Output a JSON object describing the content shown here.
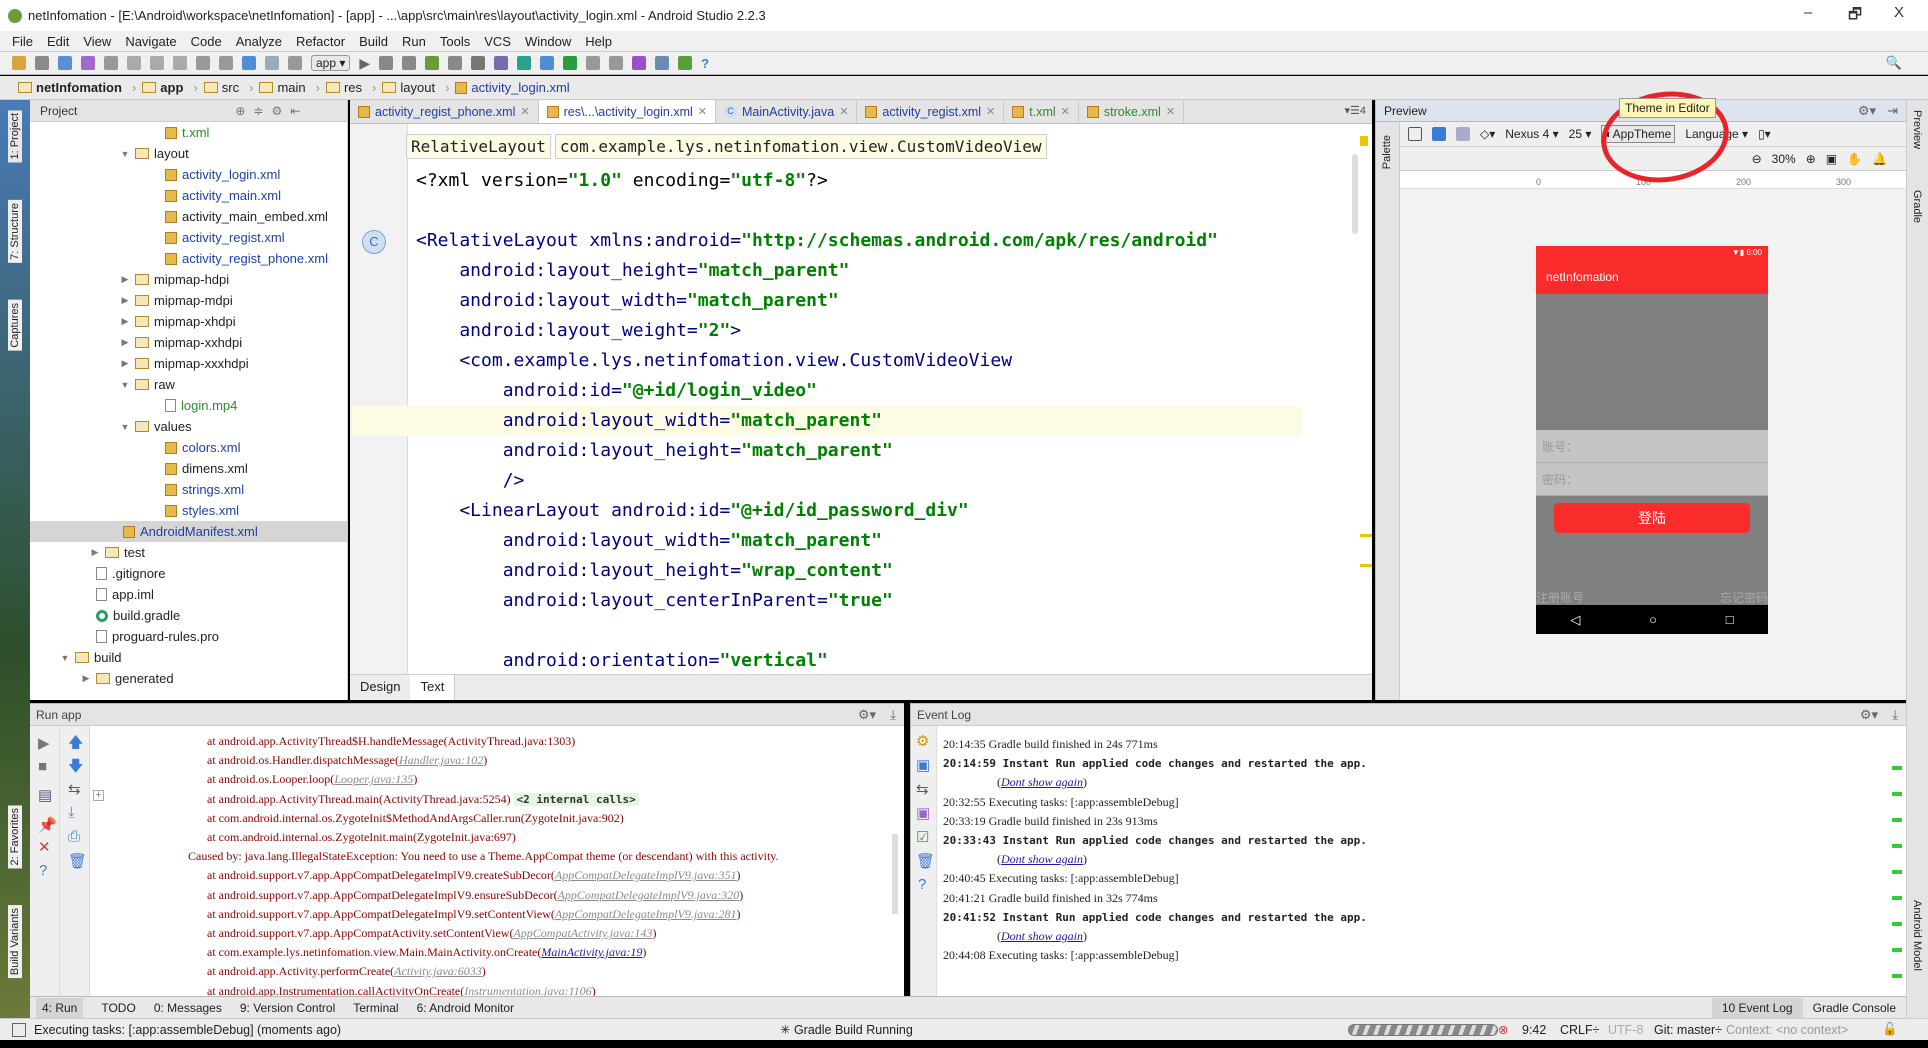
{
  "window": {
    "title": "netInfomation - [E:\\Android\\workspace\\netInfomation] - [app] - ...\\app\\src\\main\\res\\layout\\activity_login.xml - Android Studio 2.2.3",
    "minimize": "–",
    "restore": "🗗",
    "close": "X"
  },
  "menu": [
    "File",
    "Edit",
    "View",
    "Navigate",
    "Code",
    "Analyze",
    "Refactor",
    "Build",
    "Run",
    "Tools",
    "VCS",
    "Window",
    "Help"
  ],
  "toolbar": {
    "run_config": "app ▾"
  },
  "breadcrumb": [
    "netInfomation",
    "app",
    "src",
    "main",
    "res",
    "layout",
    "activity_login.xml"
  ],
  "side_tabs": {
    "project": "1: Project",
    "structure": "7: Structure",
    "captures": "Captures",
    "favorites": "2: Favorites",
    "build_variants": "Build Variants",
    "preview": "Preview",
    "gradle": "Gradle",
    "android_model": "Android Model"
  },
  "project": {
    "header": "Project",
    "items": [
      {
        "label": "t.xml",
        "indent": 4,
        "kind": "xml",
        "color": "green"
      },
      {
        "label": "layout",
        "indent": 3,
        "kind": "folder",
        "arrow": "▼"
      },
      {
        "label": "activity_login.xml",
        "indent": 4,
        "kind": "xml",
        "color": "blue"
      },
      {
        "label": "activity_main.xml",
        "indent": 4,
        "kind": "xml",
        "color": "blue"
      },
      {
        "label": "activity_main_embed.xml",
        "indent": 4,
        "kind": "xml",
        "color": "black"
      },
      {
        "label": "activity_regist.xml",
        "indent": 4,
        "kind": "xml",
        "color": "blue"
      },
      {
        "label": "activity_regist_phone.xml",
        "indent": 4,
        "kind": "xml",
        "color": "blue"
      },
      {
        "label": "mipmap-hdpi",
        "indent": 3,
        "kind": "folder",
        "arrow": "▶"
      },
      {
        "label": "mipmap-mdpi",
        "indent": 3,
        "kind": "folder",
        "arrow": "▶"
      },
      {
        "label": "mipmap-xhdpi",
        "indent": 3,
        "kind": "folder",
        "arrow": "▶"
      },
      {
        "label": "mipmap-xxhdpi",
        "indent": 3,
        "kind": "folder",
        "arrow": "▶"
      },
      {
        "label": "mipmap-xxxhdpi",
        "indent": 3,
        "kind": "folder",
        "arrow": "▶"
      },
      {
        "label": "raw",
        "indent": 3,
        "kind": "folder",
        "arrow": "▼"
      },
      {
        "label": "login.mp4",
        "indent": 4,
        "kind": "file",
        "color": "green"
      },
      {
        "label": "values",
        "indent": 3,
        "kind": "folder",
        "arrow": "▼"
      },
      {
        "label": "colors.xml",
        "indent": 4,
        "kind": "xml",
        "color": "blue"
      },
      {
        "label": "dimens.xml",
        "indent": 4,
        "kind": "xml",
        "color": "black"
      },
      {
        "label": "strings.xml",
        "indent": 4,
        "kind": "xml",
        "color": "blue"
      },
      {
        "label": "styles.xml",
        "indent": 4,
        "kind": "xml",
        "color": "blue"
      },
      {
        "label": "AndroidManifest.xml",
        "indent": 2.6,
        "kind": "xml",
        "color": "blue",
        "selected": true
      },
      {
        "label": "test",
        "indent": 2,
        "kind": "folder",
        "arrow": "▶"
      },
      {
        "label": ".gitignore",
        "indent": 1.7,
        "kind": "file"
      },
      {
        "label": "app.iml",
        "indent": 1.7,
        "kind": "file"
      },
      {
        "label": "build.gradle",
        "indent": 1.7,
        "kind": "gradle"
      },
      {
        "label": "proguard-rules.pro",
        "indent": 1.7,
        "kind": "file"
      },
      {
        "label": "build",
        "indent": 1,
        "kind": "folder",
        "arrow": "▼"
      },
      {
        "label": "generated",
        "indent": 1.7,
        "kind": "folder",
        "arrow": "▶"
      }
    ]
  },
  "tabs": [
    {
      "label": "activity_regist_phone.xml",
      "color": "blue"
    },
    {
      "label": "res\\...\\activity_login.xml",
      "color": "blue",
      "active": true
    },
    {
      "label": "MainActivity.java",
      "color": "blue",
      "icon": "C"
    },
    {
      "label": "activity_regist.xml",
      "color": "blue"
    },
    {
      "label": "t.xml",
      "color": "green"
    },
    {
      "label": "stroke.xml",
      "color": "green"
    }
  ],
  "tabs_overflow": "▾☰4",
  "editor": {
    "breadcrumb": [
      "RelativeLayout",
      "com.example.lys.netinfomation.view.CustomVideoView"
    ],
    "lines": [
      [
        [
          "<?xml version=",
          "pi"
        ],
        [
          "\"1.0\"",
          "val"
        ],
        [
          " encoding=",
          "pi"
        ],
        [
          "\"utf-8\"",
          "val"
        ],
        [
          "?>",
          "pi"
        ]
      ],
      [
        [
          "<RelativeLayout ",
          "tag"
        ],
        [
          "xmlns:android=",
          "attr"
        ],
        [
          "\"http://schemas.android.com/apk/res/android\"",
          "val"
        ]
      ],
      [
        [
          "    android:layout_height=",
          "attr"
        ],
        [
          "\"match_parent\"",
          "val"
        ]
      ],
      [
        [
          "    android:layout_width=",
          "attr"
        ],
        [
          "\"match_parent\"",
          "val"
        ]
      ],
      [
        [
          "    android:layout_weight=",
          "attr"
        ],
        [
          "\"2\"",
          "val"
        ],
        [
          ">",
          "tag"
        ]
      ],
      [
        [
          "    <com.example.lys.netinfomation.view.CustomVideoView",
          "tag"
        ]
      ],
      [
        [
          "        android:id=",
          "attr"
        ],
        [
          "\"@+id/login_video\"",
          "val"
        ]
      ],
      [
        [
          "        android:layout_width=",
          "attr"
        ],
        [
          "\"match_parent\"",
          "val"
        ]
      ],
      [
        [
          "        android:layout_height=",
          "attr"
        ],
        [
          "\"match_parent\"",
          "val"
        ]
      ],
      [
        [
          "        />",
          "tag"
        ]
      ],
      [
        [
          "    <LinearLayout ",
          "tag"
        ],
        [
          "android:id=",
          "attr"
        ],
        [
          "\"@+id/id_password_div\"",
          "val"
        ]
      ],
      [
        [
          "        android:layout_width=",
          "attr"
        ],
        [
          "\"match_parent\"",
          "val"
        ]
      ],
      [
        [
          "        android:layout_height=",
          "attr"
        ],
        [
          "\"wrap_content\"",
          "val"
        ]
      ],
      [
        [
          "        android:layout_centerInParent=",
          "attr"
        ],
        [
          "\"true\"",
          "val"
        ]
      ],
      [],
      [
        [
          "        android:orientation=",
          "attr"
        ],
        [
          "\"vertical\"",
          "val"
        ]
      ]
    ],
    "highlight_line": 7,
    "bottom_tabs": [
      "Design",
      "Text"
    ]
  },
  "preview": {
    "title": "Preview",
    "palette": "Palette",
    "device": "Nexus 4 ▾",
    "api": "25 ▾",
    "theme": "AppTheme",
    "language": "Language ▾",
    "zoom": "30%",
    "tooltip": "Theme in Editor",
    "ruler": [
      "0",
      "100",
      "200",
      "300"
    ],
    "phone": {
      "time": "6:00",
      "app_title": "netInfomation",
      "account_hint": "账号：",
      "password_hint": "密码：",
      "login_button": "登陆",
      "register_link": "注册账号",
      "forgot_link": "忘记密码",
      "nav": [
        "◁",
        "○",
        "□"
      ]
    }
  },
  "run": {
    "header": "Run",
    "config": "app",
    "lines": [
      {
        "indent": "at",
        "text": "at android.app.ActivityThread$H.handleMessage(ActivityThread.java:1303)"
      },
      {
        "text": "at android.os.Handler.dispatchMessage(",
        "link": "Handler.java:102",
        "end": ")"
      },
      {
        "text": "at android.os.Looper.loop(",
        "link": "Looper.java:135",
        "end": ")"
      },
      {
        "text": "at android.app.ActivityThread.main(ActivityThread.java:5254) ",
        "internal": "<2 internal calls>"
      },
      {
        "text": "at com.android.internal.os.ZygoteInit$MethodAndArgsCaller.run(ZygoteInit.java:902)"
      },
      {
        "text": "at com.android.internal.os.ZygoteInit.main(ZygoteInit.java:697)"
      },
      {
        "caused": true,
        "text": "Caused by: java.lang.IllegalStateException: You need to use a Theme.AppCompat theme (or descendant) with this activity."
      },
      {
        "text": "at android.support.v7.app.AppCompatDelegateImplV9.createSubDecor(",
        "link": "AppCompatDelegateImplV9.java:351",
        "end": ")"
      },
      {
        "text": "at android.support.v7.app.AppCompatDelegateImplV9.ensureSubDecor(",
        "link": "AppCompatDelegateImplV9.java:320",
        "end": ")"
      },
      {
        "text": "at android.support.v7.app.AppCompatDelegateImplV9.setContentView(",
        "link": "AppCompatDelegateImplV9.java:281",
        "end": ")"
      },
      {
        "text": "at android.support.v7.app.AppCompatActivity.setContentView(",
        "link": "AppCompatActivity.java:143",
        "end": ")"
      },
      {
        "text": "at com.example.lys.netinfomation.view.Main.MainActivity.onCreate(",
        "link": "MainActivity.java:19",
        "end": ")",
        "blue": true
      },
      {
        "text": "at android.app.Activity.performCreate(",
        "link": "Activity.java:6033",
        "end": ")"
      },
      {
        "text": "at android.app.Instrumentation.callActivityOnCreate(",
        "link": "Instrumentation.java:1106",
        "end": ")"
      }
    ]
  },
  "event_log": {
    "header": "Event Log",
    "lines": [
      {
        "text": "20:14:35 Gradle build finished in 24s 771ms"
      },
      {
        "text": "20:14:59 Instant Run applied code changes and restarted the app.",
        "bold": true
      },
      {
        "link": "Dont show again"
      },
      {
        "text": "20:32:55 Executing tasks: [:app:assembleDebug]"
      },
      {
        "text": "20:33:19 Gradle build finished in 23s 913ms"
      },
      {
        "text": "20:33:43 Instant Run applied code changes and restarted the app.",
        "bold": true
      },
      {
        "link": "Dont show again"
      },
      {
        "text": "20:40:45 Executing tasks: [:app:assembleDebug]"
      },
      {
        "text": "20:41:21 Gradle build finished in 32s 774ms"
      },
      {
        "text": "20:41:52 Instant Run applied code changes and restarted the app.",
        "bold": true
      },
      {
        "link": "Dont show again"
      },
      {
        "text": "20:44:08 Executing tasks: [:app:assembleDebug]"
      }
    ]
  },
  "tool_tabs": [
    "4: Run",
    "TODO",
    "0: Messages",
    "9: Version Control",
    "Terminal",
    "6: Android Monitor"
  ],
  "tool_tabs_right": [
    "10 Event Log",
    "Gradle Console"
  ],
  "status": {
    "message": "Executing tasks: [:app:assembleDebug] (moments ago)",
    "gradle": "Gradle Build Running",
    "position": "9:42",
    "line_sep": "CRLF÷",
    "encoding": "UTF-8",
    "git": "Git: master÷",
    "context": "Context: <no context>"
  }
}
